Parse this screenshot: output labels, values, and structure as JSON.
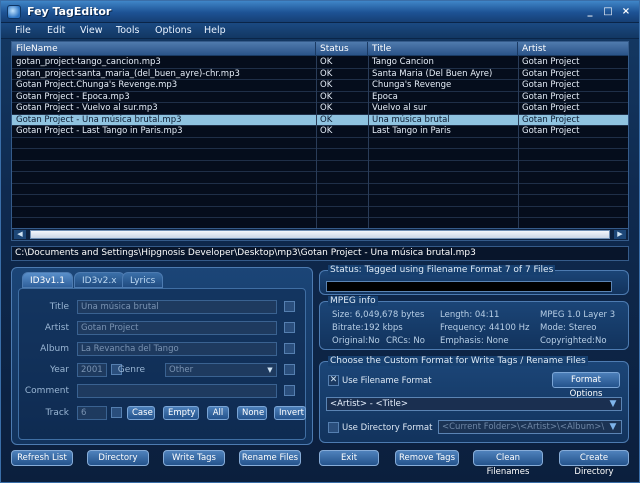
{
  "window": {
    "title": "Fey TagEditor",
    "controls": [
      "_",
      "□",
      "×"
    ]
  },
  "menu": [
    {
      "label": "File"
    },
    {
      "label": "Edit"
    },
    {
      "label": "View"
    },
    {
      "label": "Tools"
    },
    {
      "label": "Options"
    },
    {
      "label": "Help"
    }
  ],
  "file_list": {
    "columns": [
      "FileName",
      "Status",
      "Title",
      "Artist"
    ],
    "rows": [
      {
        "file": "gotan_project-tango_cancion.mp3",
        "status": "OK",
        "title": "Tango Cancion",
        "artist": "Gotan Project"
      },
      {
        "file": "gotan_project-santa_maria_(del_buen_ayre)-chr.mp3",
        "status": "OK",
        "title": "Santa Maria (Del Buen Ayre)",
        "artist": "Gotan Project"
      },
      {
        "file": "Gotan Project.Chunga's Revenge.mp3",
        "status": "OK",
        "title": "Chunga's Revenge",
        "artist": "Gotan Project"
      },
      {
        "file": "Gotan Project - Época.mp3",
        "status": "OK",
        "title": "Época",
        "artist": "Gotan Project"
      },
      {
        "file": "Gotan Project - Vuelvo al sur.mp3",
        "status": "OK",
        "title": "Vuelvo al sur",
        "artist": "Gotan Project"
      },
      {
        "file": "Gotan Project - Una música brutal.mp3",
        "status": "OK",
        "title": "Una música brutal",
        "artist": "Gotan Project",
        "selected": true
      },
      {
        "file": "Gotan Project - Last Tango in Paris.mp3",
        "status": "OK",
        "title": "Last Tango in Paris",
        "artist": "Gotan Project"
      }
    ]
  },
  "path": "C:\\Documents and Settings\\Hipgnosis Developer\\Desktop\\mp3\\Gotan Project - Una música brutal.mp3",
  "tag_panel": {
    "tabs": [
      "ID3v1.1",
      "ID3v2.x",
      "Lyrics"
    ],
    "active_tab": "ID3v1.1",
    "labels": {
      "title": "Title",
      "artist": "Artist",
      "album": "Album",
      "year": "Year",
      "genre": "Genre",
      "comment": "Comment",
      "track": "Track"
    },
    "values": {
      "title": "Una música brutal",
      "artist": "Gotan Project",
      "album": "La Revancha del Tango",
      "year": "2001",
      "genre": "Other",
      "comment": "",
      "track": "6"
    },
    "buttons": {
      "case": "Case",
      "empty": "Empty",
      "all": "All",
      "none": "None",
      "invert": "Invert"
    }
  },
  "status": {
    "legend": "Status: Tagged using Filename Format 7 of 7 Files",
    "progress": 1.0
  },
  "mpeg": {
    "legend": "MPEG info",
    "size": "Size: 6,049,678 bytes",
    "length": "Length: 04:11",
    "version": "MPEG 1.0 Layer 3",
    "bitrate": "Bitrate:192 kbps",
    "frequency": "Frequency: 44100 Hz",
    "mode": "Mode: Stereo",
    "original": "Original:No",
    "crcs": "CRCs: No",
    "emphasis": "Emphasis: None",
    "copyrighted": "Copyrighted:No"
  },
  "custom_format": {
    "legend": "Choose the Custom Format for Write Tags / Rename Files",
    "use_filename_label": "Use Filename Format",
    "use_filename_checked": true,
    "format_options": "Format Options",
    "filename_format": "<Artist> - <Title>",
    "use_directory_label": "Use Directory Format",
    "use_directory_checked": false,
    "directory_format": "<Current Folder>\\<Artist>\\<Album>\\"
  },
  "bottom_buttons": {
    "refresh": "Refresh List",
    "directory": "Directory",
    "write_tags": "Write Tags",
    "rename_files": "Rename Files",
    "exit": "Exit",
    "remove_tags": "Remove Tags",
    "clean_filenames": "Clean Filenames",
    "create_directory": "Create Directory"
  },
  "colors": {
    "accent": "#4f82bc",
    "selection": "#8fc3e0",
    "background": "#0f2a4f"
  }
}
